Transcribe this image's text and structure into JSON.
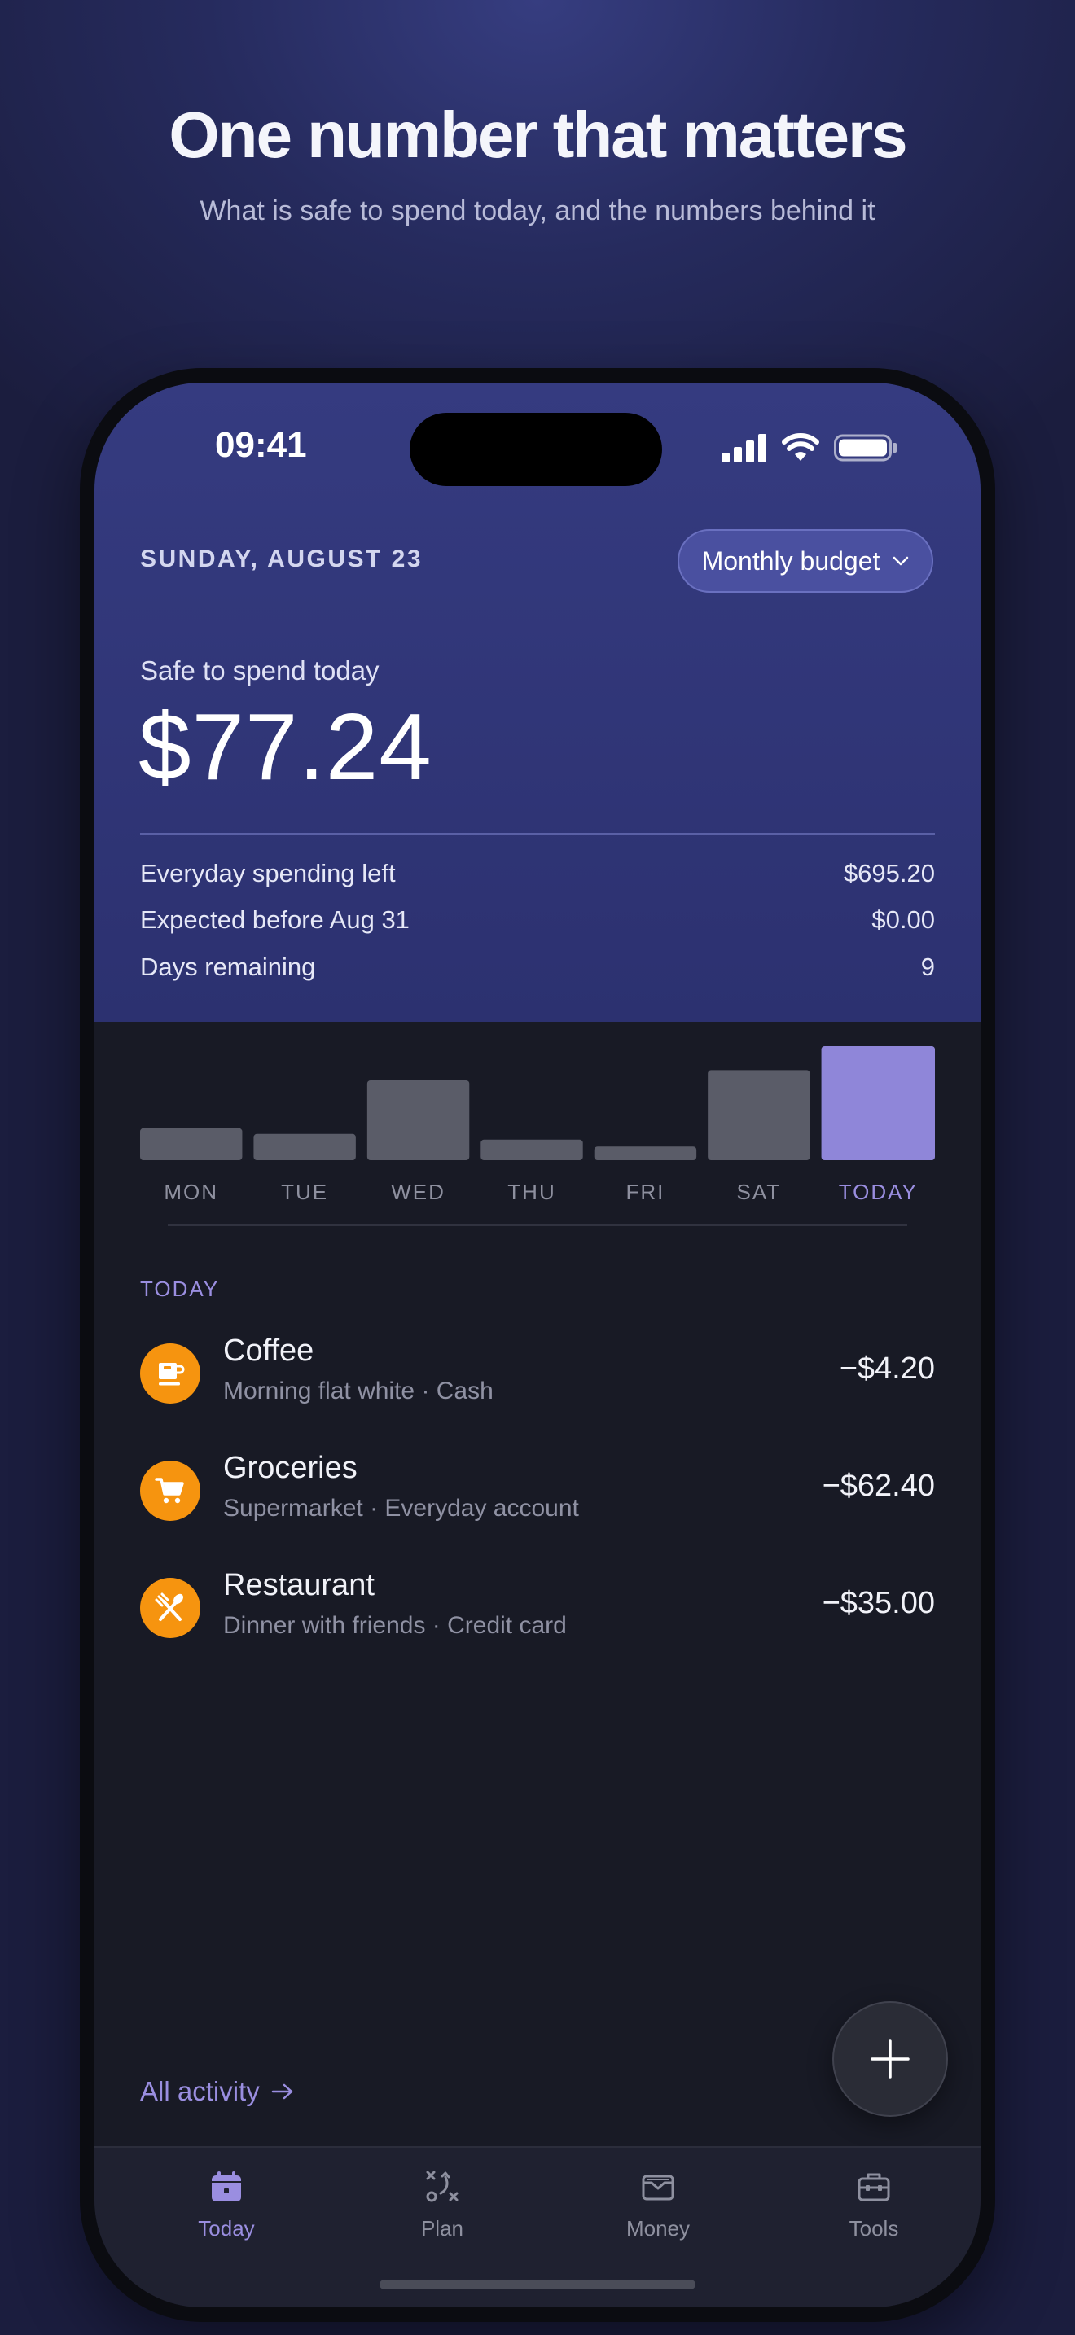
{
  "hero": {
    "title": "One number that matters",
    "subtitle": "What is safe to spend today, and the numbers behind it"
  },
  "status_bar": {
    "time": "09:41",
    "icons": [
      "cellular-signal-icon",
      "wifi-icon",
      "battery-icon"
    ]
  },
  "header": {
    "date": "SUNDAY, AUGUST 23",
    "budget_selector": "Monthly budget"
  },
  "summary": {
    "safe_label": "Safe to spend today",
    "safe_amount": "$77.24",
    "rows": [
      {
        "label": "Everyday spending left",
        "value": "$695.20"
      },
      {
        "label": "Expected before Aug 31",
        "value": "$0.00"
      },
      {
        "label": "Days remaining",
        "value": "9"
      }
    ]
  },
  "chart_data": {
    "type": "bar",
    "categories": [
      "MON",
      "TUE",
      "WED",
      "THU",
      "FRI",
      "SAT",
      "TODAY"
    ],
    "values": [
      28,
      23,
      70,
      18,
      12,
      79,
      100
    ],
    "highlight_index": 6,
    "highlight_color": "#8f86d9",
    "bar_color": "#5a5c68"
  },
  "activity": {
    "section_label": "TODAY",
    "transactions": [
      {
        "icon": "coffee-cup-icon",
        "title": "Coffee",
        "subtitle": "Morning flat white · Cash",
        "amount": "−$4.20"
      },
      {
        "icon": "shopping-cart-icon",
        "title": "Groceries",
        "subtitle": "Supermarket · Everyday account",
        "amount": "−$62.40"
      },
      {
        "icon": "fork-knife-icon",
        "title": "Restaurant",
        "subtitle": "Dinner with friends · Credit card",
        "amount": "−$35.00"
      }
    ],
    "all_activity": "All activity"
  },
  "tabs": [
    {
      "label": "Today",
      "icon": "calendar-icon",
      "active": true
    },
    {
      "label": "Plan",
      "icon": "strategy-icon",
      "active": false
    },
    {
      "label": "Money",
      "icon": "wallet-icon",
      "active": false
    },
    {
      "label": "Tools",
      "icon": "toolbox-icon",
      "active": false
    }
  ],
  "colors": {
    "accent": "#9a8ee0",
    "category_orange": "#f6940f",
    "panel": "#353b80",
    "background": "#181a25"
  }
}
